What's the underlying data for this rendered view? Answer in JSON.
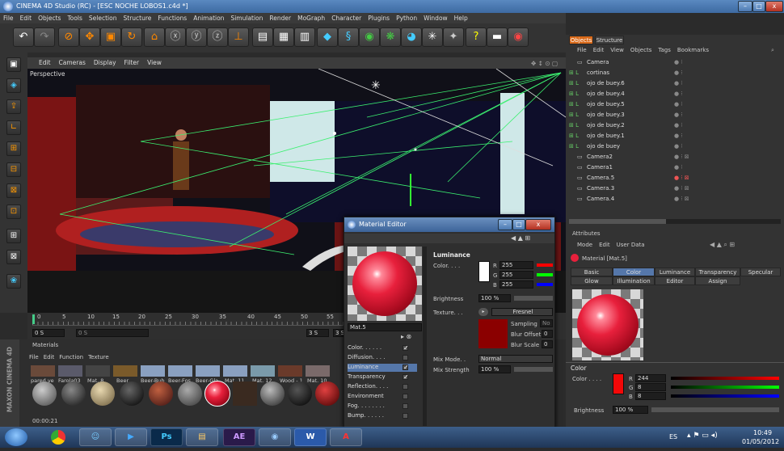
{
  "window": {
    "title": "CINEMA 4D Studio (RC) - [ESC NOCHE LOBOS1.c4d *]",
    "min": "–",
    "max": "□",
    "close": "x"
  },
  "menu": [
    "File",
    "Edit",
    "Objects",
    "Tools",
    "Selection",
    "Structure",
    "Functions",
    "Animation",
    "Simulation",
    "Render",
    "MoGraph",
    "Character",
    "Plugins",
    "Python",
    "Window",
    "Help"
  ],
  "viewport": {
    "menu": [
      "Edit",
      "Cameras",
      "Display",
      "Filter",
      "View"
    ],
    "label": "Perspective"
  },
  "timeline": {
    "ticks": [
      "0",
      "5",
      "10",
      "15",
      "20",
      "25",
      "30",
      "35",
      "40",
      "45",
      "50",
      "55"
    ],
    "start": "0 S",
    "start2": "0 S",
    "end": "3 S",
    "end2": "3 S"
  },
  "materials": {
    "header": "Materials",
    "menu": [
      "File",
      "Edit",
      "Function",
      "Texture"
    ],
    "names": [
      "pared ve",
      "Farola03",
      "Mat. 8",
      "Beer",
      "Beer-Bub",
      "Beer-Fos",
      "Beer-Gla",
      "Mat. 11",
      "Mat. 12",
      "Wood - 1",
      "Mat. 10"
    ],
    "time": "00:00:21"
  },
  "objects": {
    "tabs": [
      "Objects",
      "Structure"
    ],
    "menu": [
      "File",
      "Edit",
      "View",
      "Objects",
      "Tags",
      "Bookmarks"
    ],
    "rows": [
      "Camera",
      "cortinas",
      "ojo de buey.6",
      "ojo de buey.4",
      "ojo de buey.5",
      "ojo de buey.3",
      "ojo de buey.2",
      "ojo de buey.1",
      "ojo de buey",
      "Camera2",
      "Camera1",
      "Camera.5",
      "Camera.3",
      "Camera.4"
    ]
  },
  "attributes": {
    "header": "Attributes",
    "menu": [
      "Mode",
      "Edit",
      "User Data"
    ],
    "material": "Material [Mat.5]",
    "tabs_row1": [
      "Basic",
      "Color",
      "Luminance",
      "Transparency",
      "Specular"
    ],
    "tabs_row2": [
      "Glow",
      "Illumination",
      "Editor",
      "Assign"
    ],
    "section": "Color",
    "color_label": "Color . . . .",
    "r": "244",
    "g": "8",
    "b": "8",
    "brightness_label": "Brightness",
    "brightness": "100 %",
    "r_lbl": "R",
    "g_lbl": "G",
    "b_lbl": "B"
  },
  "material_editor": {
    "title": "Material Editor",
    "mat_name": "Mat.5",
    "section": "Luminance",
    "color_label": "Color. . . .",
    "r": "255",
    "g": "255",
    "b": "255",
    "r_lbl": "R",
    "g_lbl": "G",
    "b_lbl": "B",
    "brightness_label": "Brightness",
    "brightness": "100 %",
    "texture_label": "Texture. . .",
    "texture": "Fresnel",
    "sampling_label": "Sampling",
    "sampling": "No",
    "blur_offset_label": "Blur Offset",
    "blur_offset": "0 %",
    "blur_scale_label": "Blur Scale",
    "blur_scale": "0 %",
    "mix_mode_label": "Mix Mode. .",
    "mix_mode": "Normal",
    "mix_strength_label": "Mix Strength",
    "mix_strength": "100 %",
    "channels": [
      "Color. . . . . .",
      "Diffusion. . . .",
      "Luminance",
      "Transparency",
      "Reflection. . . .",
      "Environment",
      "Fog. . . . . . . .",
      "Bump. . . . . ."
    ],
    "checked": [
      true,
      false,
      true,
      true,
      false,
      false,
      false,
      false
    ]
  },
  "taskbar": {
    "lang": "ES",
    "time": "10:49",
    "date": "01/05/2012",
    "apps": [
      "",
      "",
      "",
      "Ps",
      "",
      "AE",
      "",
      "W",
      "A"
    ]
  },
  "side_brand": "MAXON CINEMA 4D",
  "colors": {
    "accent": "#e8203c",
    "selected_row": "#5577aa"
  }
}
